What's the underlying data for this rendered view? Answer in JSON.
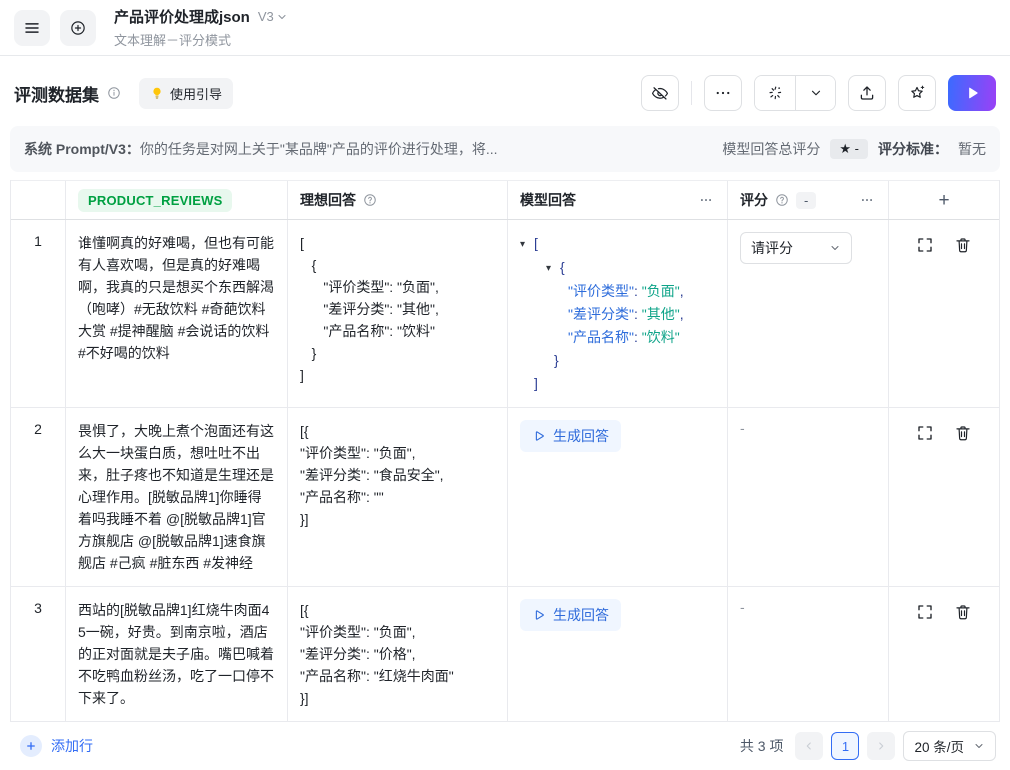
{
  "colors": {
    "accent_blue": "#336df4",
    "play_gradient_start": "#3b6bff",
    "play_gradient_end": "#9a41f6",
    "tag_green_text": "#00a042",
    "tag_green_bg": "#e8f8ee",
    "json_key": "#2d6cdb",
    "json_value": "#0fa489",
    "json_bracket": "#2c3e94"
  },
  "header": {
    "title": "产品评价处理成json",
    "version": "V3",
    "subtitle": "文本理解－评分模式"
  },
  "section": {
    "title": "评测数据集",
    "guide_label": "使用引导"
  },
  "prompt_bar": {
    "label": "系统 Prompt/V3：",
    "text": "你的任务是对网上关于\"某品牌\"产品的评价进行处理，将...",
    "total_score_label": "模型回答总评分",
    "total_score_badge": "★ -",
    "criteria_label": "评分标准：",
    "criteria_value": "暂无"
  },
  "table": {
    "header": {
      "review_tag": "PRODUCT_REVIEWS",
      "ideal": "理想回答",
      "model": "模型回答",
      "score": "评分",
      "score_dash": "-",
      "add_column": "+"
    },
    "rows": [
      {
        "num": "1",
        "review": "谁懂啊真的好难喝，但也有可能有人喜欢喝，但是真的好难喝啊，我真的只是想买个东西解渴（咆哮）#无敌饮料 #奇葩饮料大赏 #提神醒脑 #会说话的饮料 #不好喝的饮料",
        "ideal": "[\n   {\n      \"评价类型\": \"负面\",\n      \"差评分类\": \"其他\",\n      \"产品名称\": \"饮料\"\n   }\n]",
        "model": {
          "type": "tree",
          "lines": [
            {
              "cls": "open0",
              "toggle": true,
              "segs": [
                [
                  "[",
                  "bracket"
                ]
              ]
            },
            {
              "cls": "open1",
              "toggle": true,
              "segs": [
                [
                  "{",
                  "bracket"
                ]
              ]
            },
            {
              "cls": "pair",
              "toggle": false,
              "segs": [
                [
                  "\"评价类型\"",
                  "key"
                ],
                [
                  ": ",
                  "punct"
                ],
                [
                  "\"负面\"",
                  "value"
                ],
                [
                  ",",
                  "punct"
                ]
              ]
            },
            {
              "cls": "pair",
              "toggle": false,
              "segs": [
                [
                  "\"差评分类\"",
                  "key"
                ],
                [
                  ": ",
                  "punct"
                ],
                [
                  "\"其他\"",
                  "value"
                ],
                [
                  ",",
                  "punct"
                ]
              ]
            },
            {
              "cls": "pair",
              "toggle": false,
              "segs": [
                [
                  "\"产品名称\"",
                  "key"
                ],
                [
                  ": ",
                  "punct"
                ],
                [
                  "\"饮料\"",
                  "value"
                ]
              ]
            },
            {
              "cls": "close1",
              "toggle": false,
              "segs": [
                [
                  "}",
                  "bracket"
                ]
              ]
            },
            {
              "cls": "close0",
              "toggle": false,
              "segs": [
                [
                  "]",
                  "bracket"
                ]
              ]
            }
          ]
        },
        "score": {
          "type": "select",
          "label": "请评分"
        }
      },
      {
        "num": "2",
        "review": "畏惧了，大晚上煮个泡面还有这么大一块蛋白质，想吐吐不出来，肚子疼也不知道是生理还是心理作用。[脱敏品牌1]你睡得着吗我睡不着 @[脱敏品牌1]官方旗舰店 @[脱敏品牌1]速食旗舰店 #己疯 #脏东西 #发神经",
        "ideal": "[{\n\"评价类型\": \"负面\",\n\"差评分类\": \"食品安全\",\n\"产品名称\": \"\"\n}]",
        "model": {
          "type": "generate",
          "label": "生成回答"
        },
        "score": {
          "type": "dash",
          "label": "-"
        }
      },
      {
        "num": "3",
        "review": "西站的[脱敏品牌1]红烧牛肉面45一碗，好贵。到南京啦，酒店的正对面就是夫子庙。嘴巴喊着不吃鸭血粉丝汤，吃了一口停不下来了。",
        "ideal": "[{\n\"评价类型\": \"负面\",\n\"差评分类\": \"价格\",\n\"产品名称\": \"红烧牛肉面\"\n}]",
        "model": {
          "type": "generate",
          "label": "生成回答"
        },
        "score": {
          "type": "dash",
          "label": "-"
        }
      }
    ]
  },
  "footer": {
    "add_row": "添加行",
    "total": "共 3 项",
    "current_page": "1",
    "page_size": "20 条/页"
  }
}
